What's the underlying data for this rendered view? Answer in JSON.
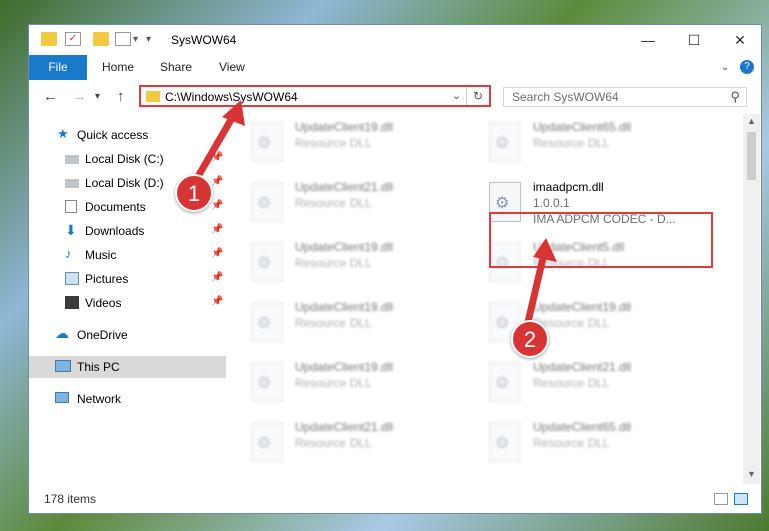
{
  "window": {
    "title": "SysWOW64",
    "minimize": "—",
    "maximize": "☐",
    "close": "✕"
  },
  "ribbon": {
    "tabs": [
      "File",
      "Home",
      "Share",
      "View"
    ],
    "help": "?"
  },
  "address_bar": {
    "path": "C:\\Windows\\SysWOW64",
    "search_placeholder": "Search SysWOW64"
  },
  "sidebar": {
    "items": [
      {
        "label": "Quick access",
        "icon": "star-icon"
      },
      {
        "label": "Local Disk (C:)",
        "icon": "drive-icon",
        "pinned": true
      },
      {
        "label": "Local Disk (D:)",
        "icon": "drive-icon",
        "pinned": true
      },
      {
        "label": "Documents",
        "icon": "documents-icon",
        "pinned": true
      },
      {
        "label": "Downloads",
        "icon": "download-icon",
        "pinned": true
      },
      {
        "label": "Music",
        "icon": "music-icon",
        "pinned": true
      },
      {
        "label": "Pictures",
        "icon": "pictures-icon",
        "pinned": true
      },
      {
        "label": "Videos",
        "icon": "videos-icon",
        "pinned": true
      },
      {
        "label": "OneDrive",
        "icon": "cloud-icon"
      },
      {
        "label": "This PC",
        "icon": "computer-icon",
        "selected": true
      },
      {
        "label": "Network",
        "icon": "network-icon"
      }
    ]
  },
  "files": {
    "left_column": [
      {
        "name": "UpdateClient19.dll",
        "type": "Resource DLL"
      },
      {
        "name": "UpdateClient21.dll",
        "type": "Resource DLL"
      },
      {
        "name": "UpdateClient19.dll",
        "type": "Resource DLL"
      },
      {
        "name": "UpdateClient19.dll",
        "type": "Resource DLL"
      },
      {
        "name": "UpdateClient19.dll",
        "type": "Resource DLL"
      },
      {
        "name": "UpdateClient21.dll",
        "type": "Resource DLL"
      }
    ],
    "highlighted": {
      "name": "imaadpcm.dll",
      "version": "1.0.0.1",
      "description": "IMA ADPCM CODEC - D..."
    },
    "right_column": [
      {
        "name": "UpdateClient65.dll",
        "type": "Resource DLL"
      },
      {
        "name": "UpdateClient5.dll",
        "type": "Resource DLL"
      },
      {
        "name": "UpdateClient19.dll",
        "type": "Resource DLL"
      },
      {
        "name": "UpdateClient21.dll",
        "type": "Resource DLL"
      },
      {
        "name": "UpdateClient65.dll",
        "type": "Resource DLL"
      }
    ]
  },
  "status_bar": {
    "item_count": "178 items"
  },
  "callouts": {
    "step1": "1",
    "step2": "2"
  },
  "colors": {
    "accent": "#1979ca",
    "highlight": "#e03a3a",
    "selection": "#d9d9d9"
  }
}
